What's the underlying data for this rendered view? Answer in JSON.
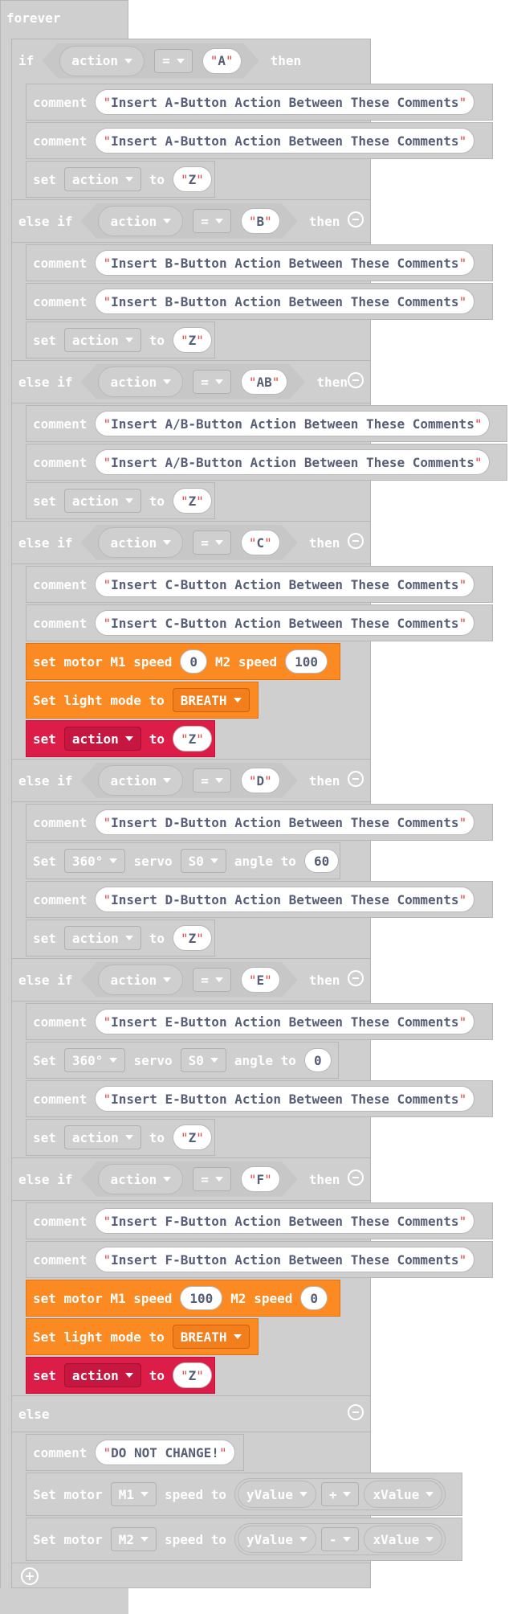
{
  "colors": {
    "disabled": "#cfcfcf",
    "motor": "#fb8a22",
    "variable": "#dc1d47",
    "text": "#ffffff",
    "string_text": "#575e75",
    "quote": "#e04848"
  },
  "kw": {
    "forever": "forever",
    "if": "if",
    "else_if": "else if",
    "else": "else",
    "then": "then",
    "comment": "comment",
    "set": "set",
    "Set": "Set",
    "to": "to",
    "servo": "servo",
    "angle_to": "angle to",
    "speed_to": "speed to",
    "set_motor_m1": "set motor M1 speed",
    "m2_speed": "M2 speed",
    "set_light_mode": "Set light mode to",
    "set_motor": "Set motor"
  },
  "vars": {
    "action": "action",
    "eq": "=",
    "plus": "+",
    "minus": "-",
    "yValue": "yValue",
    "xValue": "xValue",
    "Z": "Z",
    "breath": "BREATH",
    "deg360": "360°",
    "s0": "S0",
    "m1": "M1",
    "m2": "M2"
  },
  "cond": {
    "a": "A",
    "b": "B",
    "ab": "AB",
    "c": "C",
    "d": "D",
    "e": "E",
    "f": "F"
  },
  "comments": {
    "a": "Insert A-Button Action Between These Comments",
    "b": "Insert B-Button Action Between These Comments",
    "ab": "Insert A/B-Button Action Between These Comments",
    "c": "Insert C-Button Action Between These Comments",
    "d": "Insert D-Button Action Between These Comments",
    "e": "Insert E-Button Action Between These Comments",
    "f": "Insert F-Button Action Between These Comments",
    "else": "DO NOT CHANGE!"
  },
  "nums": {
    "c_m1": "0",
    "c_m2": "100",
    "d_angle": "60",
    "e_angle": "0",
    "f_m1": "100",
    "f_m2": "0"
  },
  "icons": {
    "collapse": "minus-circle-icon",
    "add": "plus-circle-icon",
    "dropdown": "caret-down-icon"
  }
}
